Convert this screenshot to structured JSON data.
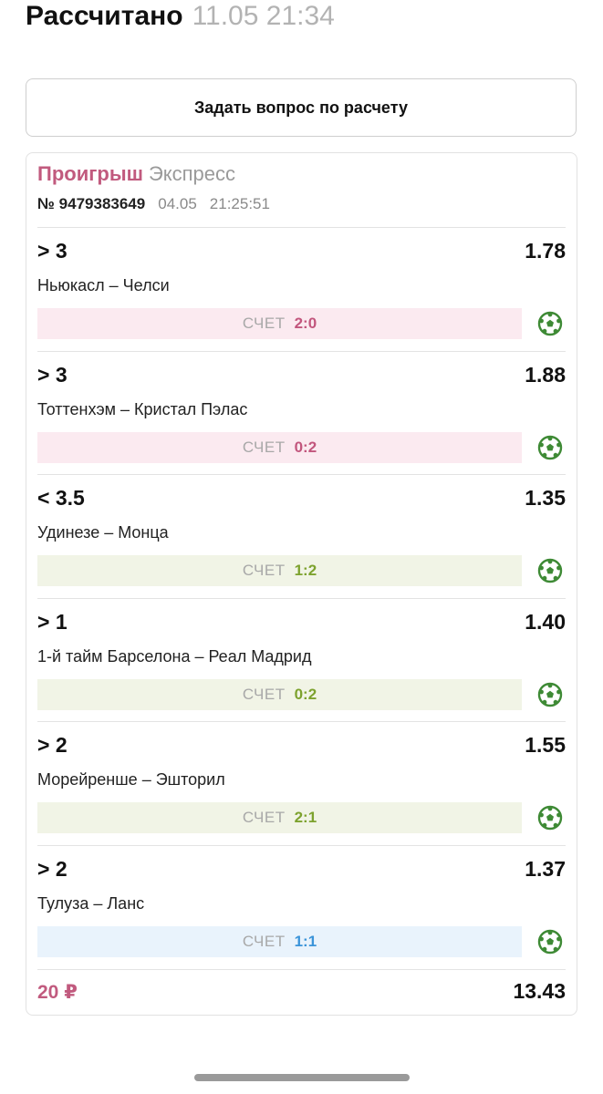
{
  "header": {
    "title": "Рассчитано",
    "timestamp": "11.05 21:34"
  },
  "ask_button": {
    "label": "Задать вопрос по расчету"
  },
  "bet": {
    "status": "Проигрыш",
    "type": "Экспресс",
    "number": "№ 9479383649",
    "date": "04.05",
    "time": "21:25:51",
    "colors": {
      "loss": "#c2567d",
      "win": "#7da22e",
      "draw": "#3b94d9"
    },
    "items": [
      {
        "condition": "> 3",
        "odds": "1.78",
        "match": "Ньюкасл – Челси",
        "score_label": "СЧЕТ",
        "score": "2:0",
        "result": "loss",
        "sport_icon": "football-icon"
      },
      {
        "condition": "> 3",
        "odds": "1.88",
        "match": "Тоттенхэм – Кристал Пэлас",
        "score_label": "СЧЕТ",
        "score": "0:2",
        "result": "loss",
        "sport_icon": "football-icon"
      },
      {
        "condition": "< 3.5",
        "odds": "1.35",
        "match": "Удинезе – Монца",
        "score_label": "СЧЕТ",
        "score": "1:2",
        "result": "win",
        "sport_icon": "football-icon"
      },
      {
        "condition": "> 1",
        "odds": "1.40",
        "match": "1-й тайм Барселона – Реал Мадрид",
        "score_label": "СЧЕТ",
        "score": "0:2",
        "result": "win",
        "sport_icon": "football-icon"
      },
      {
        "condition": "> 2",
        "odds": "1.55",
        "match": "Морейренше – Эшторил",
        "score_label": "СЧЕТ",
        "score": "2:1",
        "result": "win",
        "sport_icon": "football-icon"
      },
      {
        "condition": "> 2",
        "odds": "1.37",
        "match": "Тулуза – Ланс",
        "score_label": "СЧЕТ",
        "score": "1:1",
        "result": "draw",
        "sport_icon": "football-icon"
      }
    ],
    "stake": "20 ₽",
    "total_odds": "13.43"
  }
}
